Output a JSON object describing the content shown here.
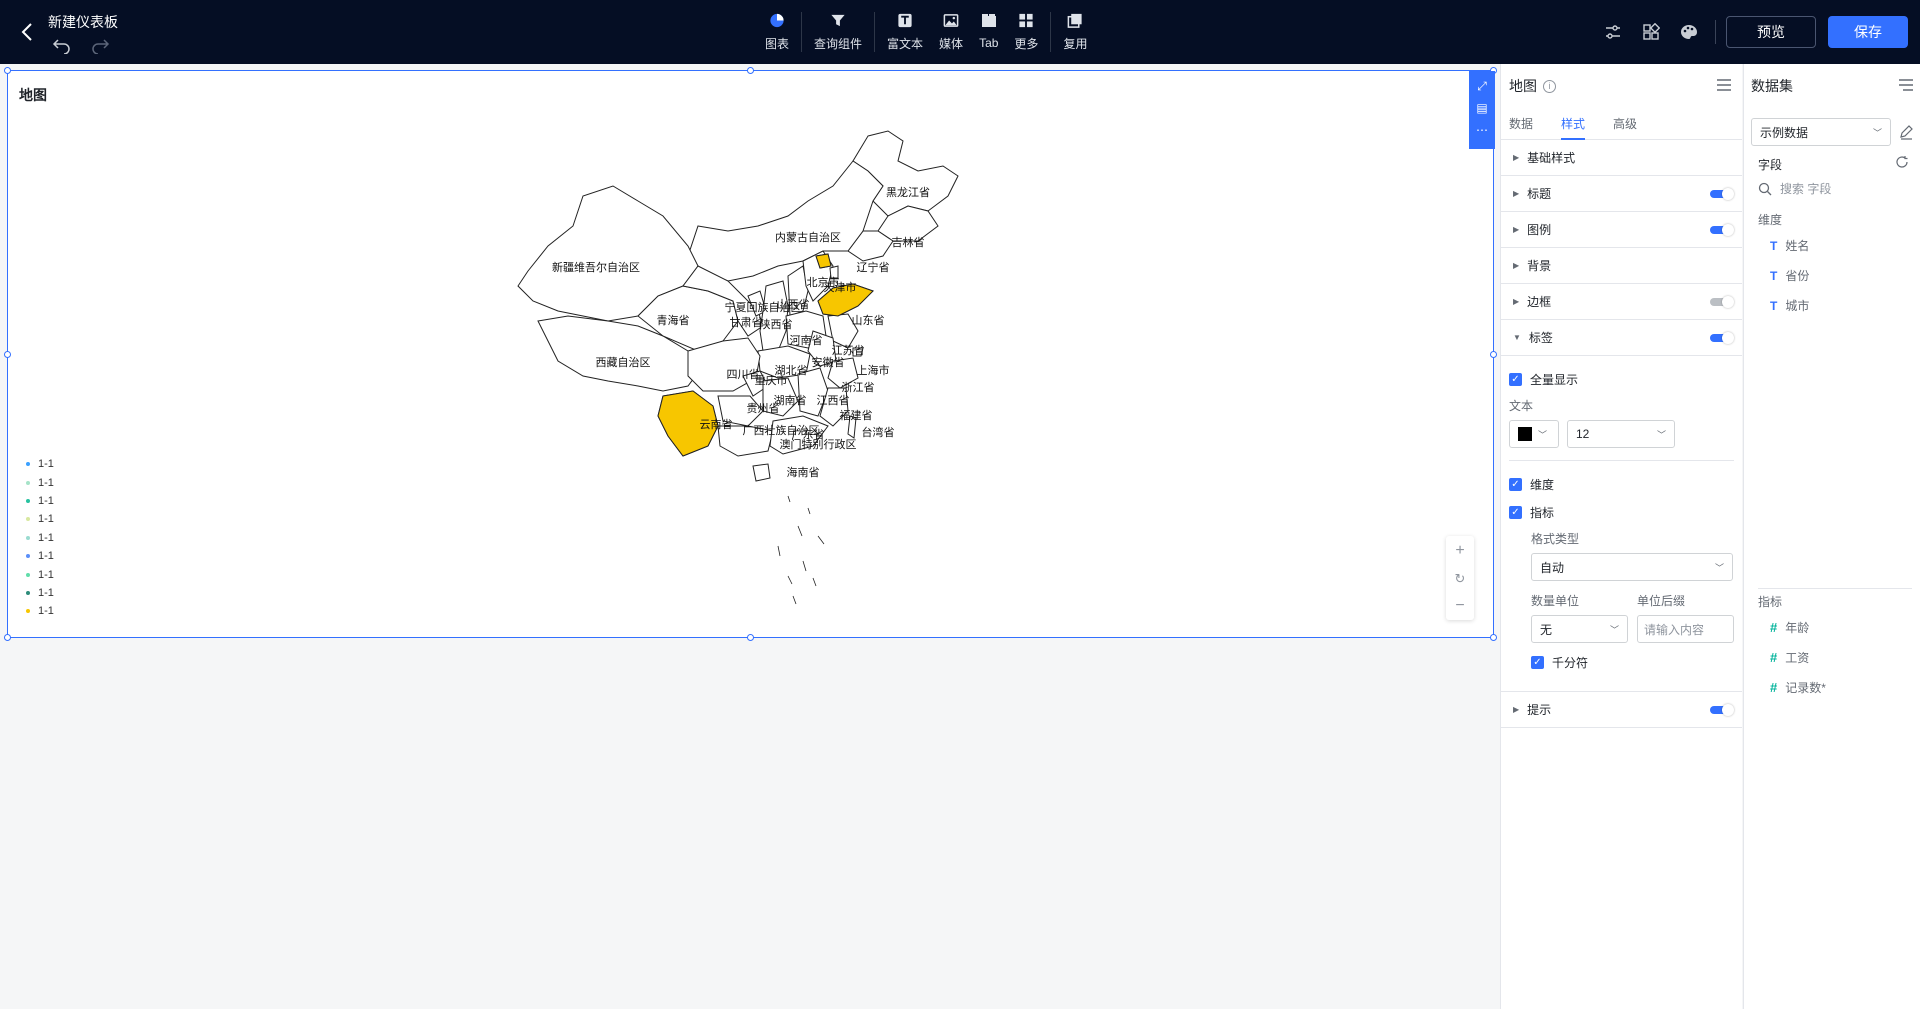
{
  "header": {
    "title": "新建仪表板",
    "tools": [
      {
        "label": "图表",
        "icon": "pie-chart-icon"
      },
      {
        "label": "查询组件",
        "icon": "filter-icon"
      },
      {
        "label": "富文本",
        "icon": "rich-text-icon"
      },
      {
        "label": "媒体",
        "icon": "image-icon"
      },
      {
        "label": "Tab",
        "icon": "tab-icon"
      },
      {
        "label": "更多",
        "icon": "grid-icon"
      },
      {
        "label": "复用",
        "icon": "copy-icon"
      }
    ],
    "preview_label": "预览",
    "save_label": "保存",
    "accent_color": "#3370ff",
    "bg_color": "#050e24"
  },
  "map_card": {
    "title": "地图",
    "legend": [
      "1-1",
      "1-1",
      "1-1",
      "1-1",
      "1-1",
      "1-1",
      "1-1",
      "1-1",
      "1-1"
    ],
    "highlight_color": "#f7c600",
    "zoom": {
      "in": "+",
      "reset": "↻",
      "out": "−"
    },
    "regions": [
      {
        "name": "黑龙江省",
        "highlight": false
      },
      {
        "name": "内蒙古自治区",
        "highlight": false
      },
      {
        "name": "吉林省",
        "highlight": false
      },
      {
        "name": "辽宁省",
        "highlight": false
      },
      {
        "name": "新疆维吾尔自治区",
        "highlight": false
      },
      {
        "name": "北京市",
        "highlight": true
      },
      {
        "name": "天津市",
        "highlight": false
      },
      {
        "name": "宁夏回族自治区",
        "highlight": false
      },
      {
        "name": "山西省",
        "highlight": false
      },
      {
        "name": "甘肃省",
        "highlight": false
      },
      {
        "name": "青海省",
        "highlight": false
      },
      {
        "name": "陕西省",
        "highlight": false
      },
      {
        "name": "山东省",
        "highlight": true
      },
      {
        "name": "河南省",
        "highlight": false
      },
      {
        "name": "江苏省",
        "highlight": false
      },
      {
        "name": "西藏自治区",
        "highlight": false
      },
      {
        "name": "安徽省",
        "highlight": false
      },
      {
        "name": "四川省",
        "highlight": false
      },
      {
        "name": "湖北省",
        "highlight": false
      },
      {
        "name": "上海市",
        "highlight": false
      },
      {
        "name": "重庆市",
        "highlight": false
      },
      {
        "name": "浙江省",
        "highlight": false
      },
      {
        "name": "湖南省",
        "highlight": false
      },
      {
        "name": "江西省",
        "highlight": false
      },
      {
        "name": "贵州省",
        "highlight": false
      },
      {
        "name": "福建省",
        "highlight": false
      },
      {
        "name": "云南省",
        "highlight": true
      },
      {
        "name": "广西壮族自治区",
        "highlight": false
      },
      {
        "name": "广东省",
        "highlight": false
      },
      {
        "name": "台湾省",
        "highlight": false
      },
      {
        "name": "澳门特别行政区",
        "highlight": false
      },
      {
        "name": "海南省",
        "highlight": false
      }
    ]
  },
  "style_panel": {
    "title": "地图",
    "tabs": [
      "数据",
      "样式",
      "高级"
    ],
    "active_tab": "样式",
    "sections": [
      {
        "label": "基础样式",
        "toggle": null
      },
      {
        "label": "标题",
        "toggle": "on"
      },
      {
        "label": "图例",
        "toggle": "on"
      },
      {
        "label": "背景",
        "toggle": null
      },
      {
        "label": "边框",
        "toggle": "off"
      },
      {
        "label": "标签",
        "toggle": "on"
      }
    ],
    "label_settings": {
      "show_all": "全量显示",
      "text_label": "文本",
      "text_color": "#000000",
      "font_size": "12",
      "dimension": "维度",
      "metric": "指标",
      "format_type_label": "格式类型",
      "format_type_value": "自动",
      "unit_label": "数量单位",
      "unit_value": "无",
      "suffix_label": "单位后缀",
      "suffix_placeholder": "请输入内容",
      "thousands": "千分符"
    },
    "tooltip_section": "提示"
  },
  "dataset_panel": {
    "title": "数据集",
    "dataset": "示例数据",
    "fields_label": "字段",
    "search_placeholder": "搜索 字段",
    "dimension_label": "维度",
    "dimensions": [
      "姓名",
      "省份",
      "城市"
    ],
    "metric_label": "指标",
    "metrics": [
      "年龄",
      "工资",
      "记录数*"
    ]
  }
}
